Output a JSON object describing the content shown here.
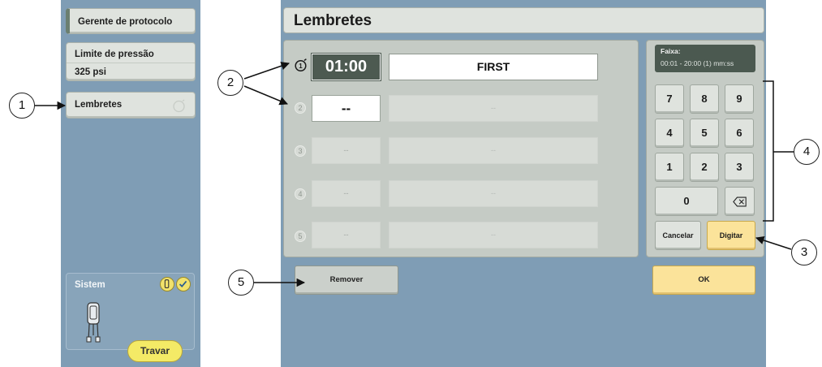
{
  "sidebar": {
    "protocol_manager": "Gerente de protocolo",
    "pressure_limit_label": "Limite de pressão",
    "pressure_limit_value": "325 psi",
    "reminders": "Lembretes",
    "system_label": "Sistem",
    "lock_button": "Travar"
  },
  "main": {
    "title": "Lembretes",
    "reminders": [
      {
        "number": "1",
        "time": "01:00",
        "name": "FIRST"
      },
      {
        "number": "2",
        "time": "--",
        "name": "--"
      },
      {
        "number": "3",
        "time": "--",
        "name": "--"
      },
      {
        "number": "4",
        "time": "--",
        "name": "--"
      },
      {
        "number": "5",
        "time": "--",
        "name": "--"
      }
    ],
    "remove_button": "Remover"
  },
  "keypad": {
    "range_label": "Faixa:",
    "range_value": "00:01 - 20:00 (1) mm:ss",
    "keys": [
      "7",
      "8",
      "9",
      "4",
      "5",
      "6",
      "1",
      "2",
      "3",
      "0"
    ],
    "cancel_button": "Cancelar",
    "enter_button": "Digitar",
    "ok_button": "OK"
  },
  "callouts": [
    "1",
    "2",
    "3",
    "4",
    "5"
  ],
  "icons": {
    "reminder": "stopwatch-icon",
    "backspace": "backspace-icon",
    "system_status": "check-icon",
    "injector": "injector-icon"
  },
  "colors": {
    "background": "#7f9db5",
    "panel": "#c5cbc5",
    "button": "#dfe3de",
    "accent_yellow": "#fbe39a",
    "dark_field": "#4d5a51"
  }
}
